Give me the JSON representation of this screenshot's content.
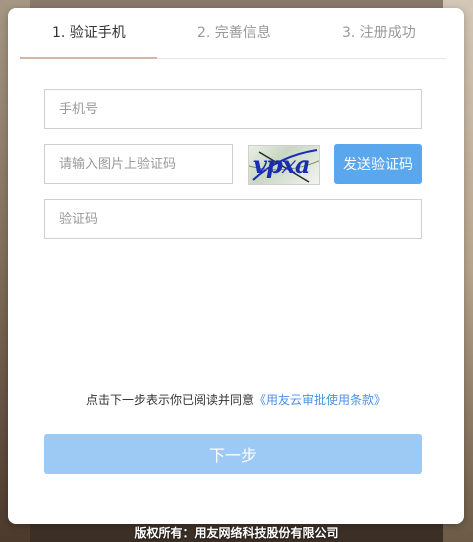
{
  "steps": [
    {
      "label": "1. 验证手机",
      "active": true
    },
    {
      "label": "2. 完善信息",
      "active": false
    },
    {
      "label": "3. 注册成功",
      "active": false
    }
  ],
  "form": {
    "phone_placeholder": "手机号",
    "captcha_placeholder": "请输入图片上验证码",
    "captcha_image_text": "vpxa",
    "send_code_label": "发送验证码",
    "sms_code_placeholder": "验证码"
  },
  "agreement": {
    "text": "点击下一步表示你已阅读并同意",
    "link": "《用友云审批使用条款》"
  },
  "next_button_label": "下一步",
  "footer_text": "版权所有：用友网络科技股份有限公司",
  "colors": {
    "accent": "#5aa7ee",
    "next_button": "#9dc9f5",
    "link": "#4a90e2",
    "active_step_underline": "#d8b3a9"
  }
}
